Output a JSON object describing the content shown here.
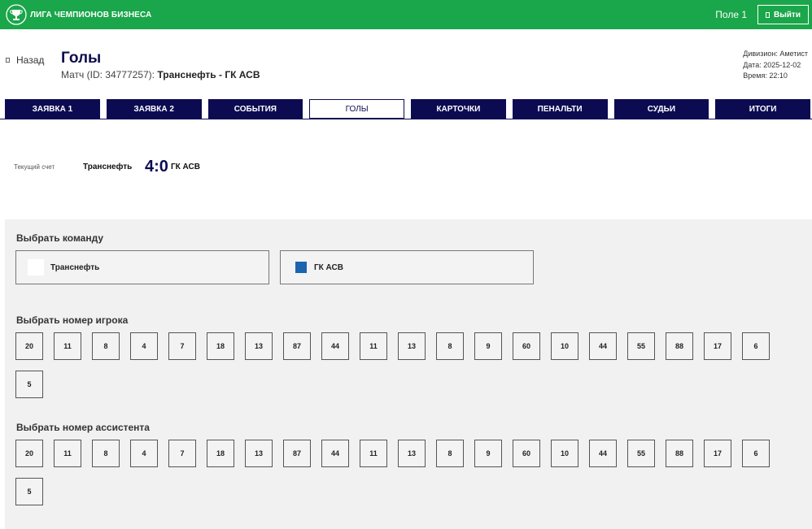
{
  "header": {
    "logo_text": "ЛИГА ЧЕМПИОНОВ БИЗНЕСА",
    "field": "Поле 1",
    "logout_label": "Выйти"
  },
  "page": {
    "back_label": "Назад",
    "title": "Голы",
    "match_prefix": "Матч (ID: 34777257):",
    "match_name": "Транснефть - ГК АСВ",
    "division": "Дивизион: Аметист",
    "date": "Дата: 2025-12-02",
    "time": "Время: 22:10"
  },
  "tabs": [
    "ЗАЯВКА 1",
    "ЗАЯВКА 2",
    "СОБЫТИЯ",
    "ГОЛЫ",
    "КАРТОЧКИ",
    "ПЕНАЛЬТИ",
    "СУДЬИ",
    "ИТОГИ"
  ],
  "active_tab": "ГОЛЫ",
  "score": {
    "label": "Текущий счет",
    "team1": "Транснефть",
    "value": "4:0",
    "team2": "ГК АСВ"
  },
  "team_select": {
    "title": "Выбрать команду",
    "teams": [
      {
        "name": "Транснефть",
        "color": "#ffffff"
      },
      {
        "name": "ГК АСВ",
        "color": "#1c63b0"
      }
    ]
  },
  "player_select": {
    "title": "Выбрать номер игрока",
    "numbers": [
      "20",
      "11",
      "8",
      "4",
      "7",
      "18",
      "13",
      "87",
      "44",
      "11",
      "13",
      "8",
      "9",
      "60",
      "10",
      "44",
      "55",
      "88",
      "17",
      "6",
      "5"
    ]
  },
  "assistant_select": {
    "title": "Выбрать номер ассистента",
    "numbers": [
      "20",
      "11",
      "8",
      "4",
      "7",
      "18",
      "13",
      "87",
      "44",
      "11",
      "13",
      "8",
      "9",
      "60",
      "10",
      "44",
      "55",
      "88",
      "17",
      "6",
      "5"
    ]
  },
  "colors": {
    "brand_green": "#1aa64a",
    "navy": "#0c0b52",
    "panel_bg": "#f1f1f1"
  }
}
